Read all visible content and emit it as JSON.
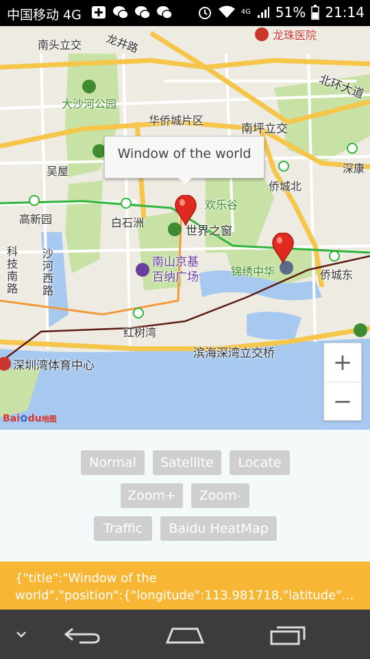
{
  "status_bar": {
    "carrier": "中国移动 4G",
    "network_label": "4G",
    "battery": "51%",
    "time": "21:14",
    "icons": [
      "add-box-icon",
      "wechat-icon",
      "wechat-icon",
      "wechat-icon",
      "alarm-icon",
      "wifi-icon",
      "signal-icon",
      "battery-icon"
    ]
  },
  "map": {
    "labels": {
      "nantou": "南头立交",
      "longjing": "龙井路",
      "longzhu": "龙珠医院",
      "beihuan": "北环大道",
      "dashahe": "大沙河公园",
      "huaqiao": "华侨城片区",
      "nanping": "南坪立交",
      "wuwu": "吴屋",
      "shenkang": "深康",
      "qiaochengbei": "侨城北",
      "huanlegu": "欢乐谷",
      "gaoxin": "高新园",
      "baishizhou": "白石洲",
      "shijie": "世界之窗",
      "keji": "科技南路",
      "shahe": "沙河西路",
      "nanshan": "南山京基百纳广场",
      "jinxiu": "锦绣中华",
      "qiaochengdong": "侨城东",
      "hongshuwan": "红树湾",
      "binhai": "滨海深湾立交桥",
      "shenzhenwan": "深圳湾体育中心"
    },
    "info_window": {
      "title": "Window of the world"
    },
    "zoom_in": "+",
    "zoom_out": "−",
    "logo": {
      "bai": "Bai",
      "du": "du",
      "suffix": "地图"
    },
    "colors": {
      "water": "#a7c9f0",
      "park": "#c8e2a6",
      "road_major": "#f5c64a",
      "metro_green": "#2fb43c"
    }
  },
  "controls": {
    "normal": "Normal",
    "satellite": "Satellite",
    "locate": "Locate",
    "zoom_in": "Zoom+",
    "zoom_out": "Zoom-",
    "traffic": "Traffic",
    "heatmap": "Baidu HeatMap"
  },
  "info_bar": {
    "line1": "{\"title\":\"Window of the",
    "line2": "world\",\"position\":{\"longitude\":113.981718,\"latitude\":..."
  },
  "nav_bar": {
    "icons": [
      "chevron-down-icon",
      "back-icon",
      "home-icon",
      "recents-icon"
    ]
  }
}
